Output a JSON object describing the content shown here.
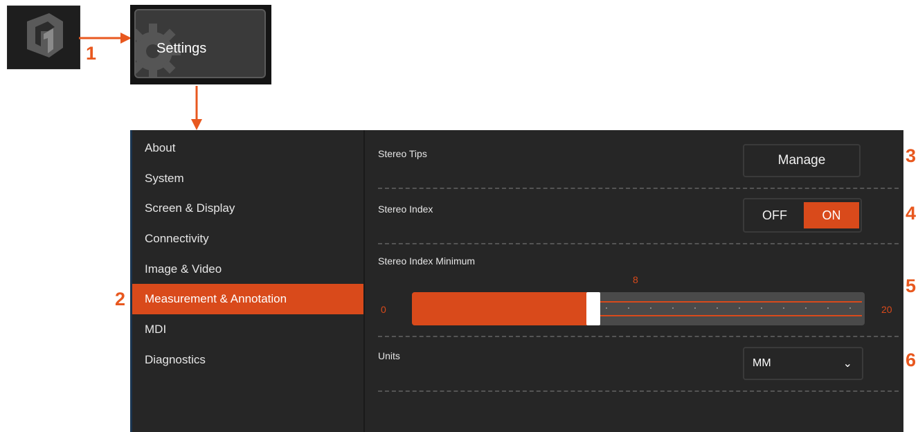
{
  "launcher": {
    "app_icon": "app-logo-icon",
    "settings_label": "Settings",
    "settings_icon": "gear-icon"
  },
  "callouts": [
    "1",
    "2",
    "3",
    "4",
    "5",
    "6"
  ],
  "sidebar": {
    "items": [
      {
        "label": "About",
        "active": false
      },
      {
        "label": "System",
        "active": false
      },
      {
        "label": "Screen & Display",
        "active": false
      },
      {
        "label": "Connectivity",
        "active": false
      },
      {
        "label": "Image & Video",
        "active": false
      },
      {
        "label": "Measurement & Annotation",
        "active": true
      },
      {
        "label": "MDI",
        "active": false
      },
      {
        "label": "Diagnostics",
        "active": false
      }
    ]
  },
  "content": {
    "stereo_tips": {
      "label": "Stereo Tips",
      "button": "Manage"
    },
    "stereo_index": {
      "label": "Stereo Index",
      "off_label": "OFF",
      "on_label": "ON",
      "value": "ON"
    },
    "stereo_index_minimum": {
      "label": "Stereo Index Minimum",
      "min": "0",
      "max": "20",
      "value": "8"
    },
    "units": {
      "label": "Units",
      "value": "MM"
    }
  },
  "colors": {
    "accent": "#d94a1b",
    "panel": "#262626"
  }
}
